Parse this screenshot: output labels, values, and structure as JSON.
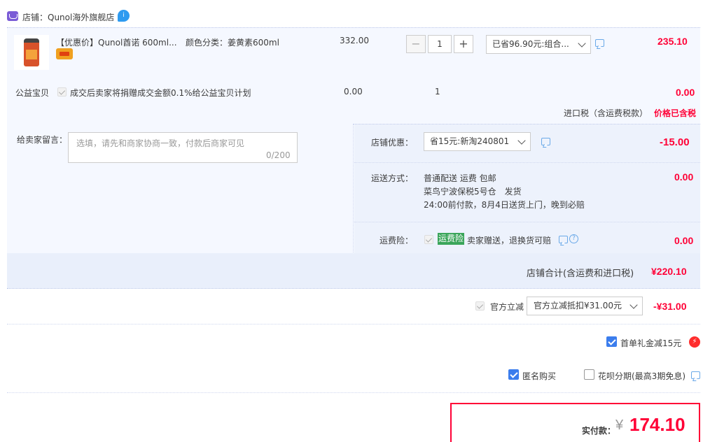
{
  "shop": {
    "label": "店铺：Qunol海外旗舰店",
    "wangwang_icon": "chat-bubble-icon",
    "wangwang_text": "i"
  },
  "item": {
    "title": "【优惠价】Qunol酋诺 600ml...",
    "sku": "颜色分类：姜黄素600ml",
    "price": "332.00",
    "quantity": "1",
    "minus_label": "−",
    "plus_label": "+",
    "promo_selected": "已省96.90元:组合...",
    "subtotal": "235.10"
  },
  "charity": {
    "label": "公益宝贝",
    "text": "成交后卖家将捐赠成交金额0.1%给公益宝贝计划",
    "price": "0.00",
    "qty": "1",
    "total": "0.00"
  },
  "tax": {
    "label": "进口税（含运费税款）",
    "value": "价格已含税"
  },
  "message": {
    "label": "给卖家留言：",
    "placeholder": "选填，请先和商家协商一致，付款后商家可见",
    "count": "0/200"
  },
  "shop_coupon": {
    "label": "店铺优惠：",
    "selected": "省15元:新淘240801",
    "value": "-15.00"
  },
  "shipping": {
    "label": "运送方式：",
    "line1": "普通配送 运费 包邮",
    "line2": "菜鸟宁波保税5号仓　发货",
    "line3": "24:00前付款，8月4日送货上门，晚到必赔",
    "value": "0.00"
  },
  "insurance": {
    "label": "运费险：",
    "tag": "运费险",
    "text": "卖家赠送，退换货可赔",
    "help": "?",
    "value": "0.00"
  },
  "shop_total": {
    "label": "店铺合计(含运费和进口税)",
    "value": "¥220.10"
  },
  "official_discount": {
    "label": "官方立减",
    "selected": "官方立减抵扣¥31.00元",
    "value": "-¥31.00"
  },
  "first_order": {
    "label": "首单礼金减15元",
    "checked": true,
    "icon": "lightning-icon",
    "icon_glyph": "⚡"
  },
  "anonymous": {
    "label": "匿名购买",
    "checked": true
  },
  "huabei": {
    "label": "花呗分期(最高3期免息)",
    "checked": false
  },
  "payment": {
    "label": "实付款：",
    "currency": "¥",
    "amount": "174.10"
  },
  "colors": {
    "accent_red": "#ff0036",
    "panel_bg": "#f5f8ff",
    "checkbox_blue": "#3b7ded",
    "insurance_green": "#3aa55a"
  }
}
